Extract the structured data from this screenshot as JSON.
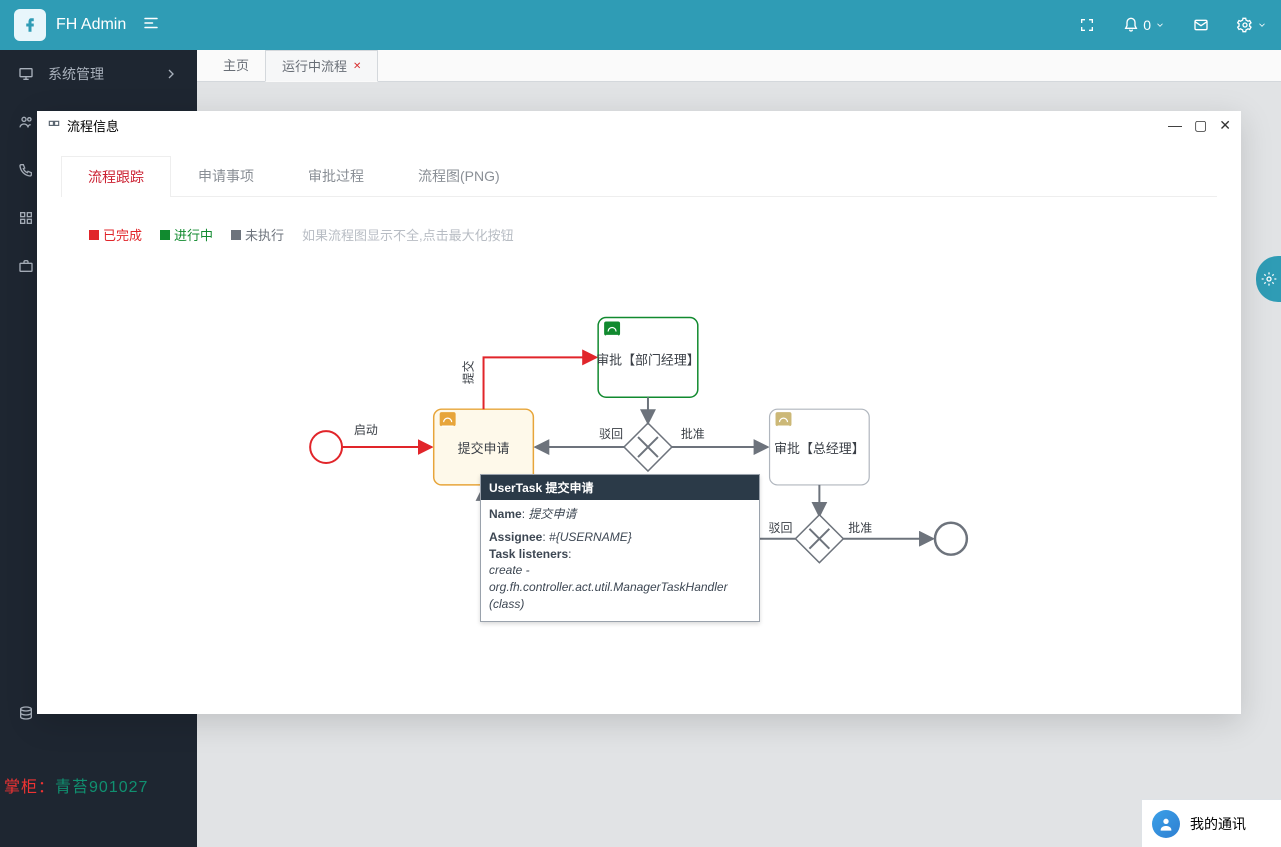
{
  "header": {
    "brand": "FH Admin",
    "notif_count": "0",
    "icons": {
      "fullscreen": "fullscreen",
      "bell": "bell",
      "mail": "mail",
      "gear": "gear"
    }
  },
  "sidebar": {
    "items": [
      {
        "label": "系统管理"
      }
    ]
  },
  "main_tabs": {
    "home": "主页",
    "running": "运行中流程"
  },
  "modal": {
    "title": "流程信息",
    "tabs": {
      "trace": "流程跟踪",
      "apply": "申请事项",
      "approve": "审批过程",
      "png": "流程图(PNG)"
    },
    "legend": {
      "done": "已完成",
      "doing": "进行中",
      "todo": "未执行",
      "hint": "如果流程图显示不全,点击最大化按钮"
    },
    "diagram": {
      "start_label": "启动",
      "submit_label": "提交",
      "task1": "提交申请",
      "task2": "审批【部门经理】",
      "task3": "审批【总经理】",
      "reject": "驳回",
      "approve": "批准"
    },
    "tooltip": {
      "head": "UserTask 提交申请",
      "name_label": "Name",
      "name_value": "提交申请",
      "assignee_label": "Assignee",
      "assignee_value": "#{USERNAME}",
      "listeners_label": "Task listeners",
      "listeners_value": "create - org.fh.controller.act.util.ManagerTaskHandler (class)"
    }
  },
  "watermark": {
    "a": "掌柜：",
    "b": "青苔901027"
  },
  "contacts": {
    "label": "我的通讯"
  },
  "colors": {
    "done": "#e1252a",
    "doing": "#118a2f",
    "todo": "#6d737c",
    "doing_fill": "#fef9ea",
    "doing_stroke": "#e7a53a"
  }
}
